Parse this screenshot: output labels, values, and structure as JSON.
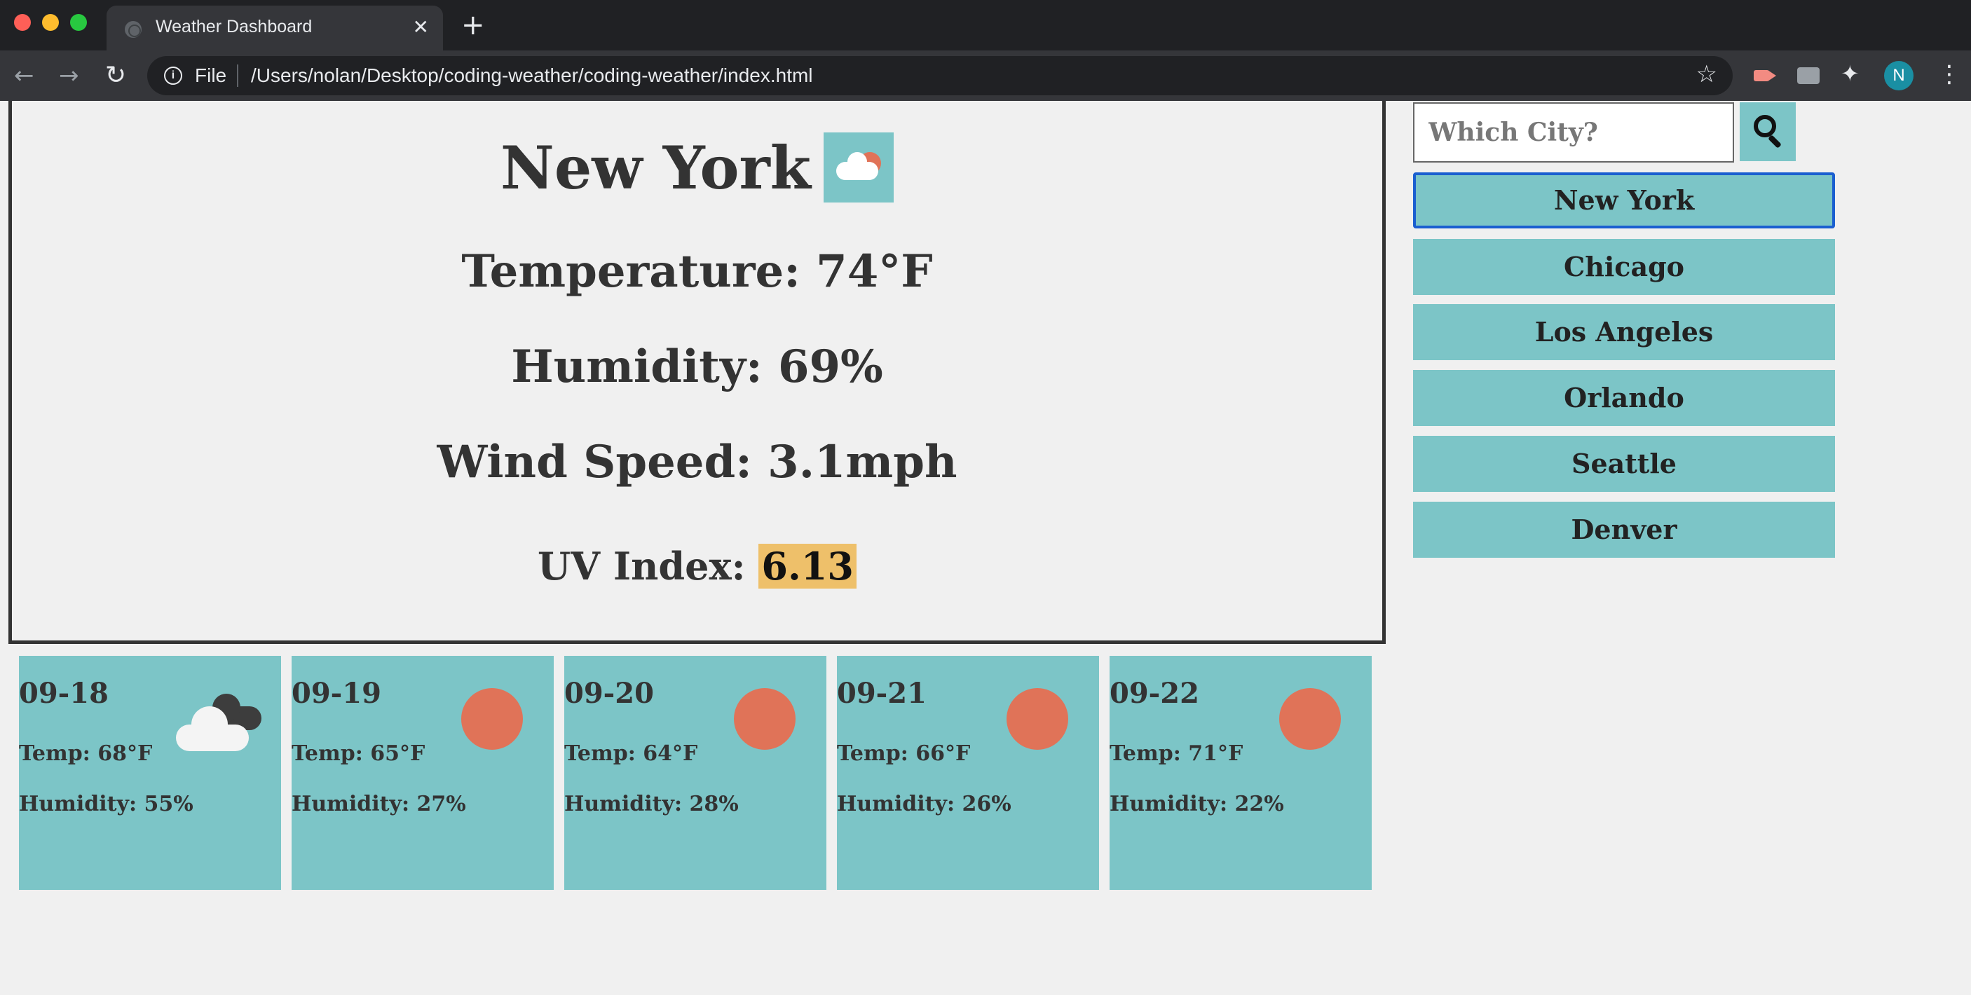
{
  "browser": {
    "tab_title": "Weather Dashboard",
    "tab_close": "✕",
    "new_tab": "+",
    "scheme": "File",
    "url": "/Users/nolan/Desktop/coding-weather/coding-weather/index.html",
    "profile_initial": "N"
  },
  "current": {
    "city": "New York",
    "temperature": "Temperature: 74°F",
    "humidity": "Humidity: 69%",
    "wind": "Wind Speed: 3.1mph",
    "uv_label": "UV Index: ",
    "uv_value": "6.13",
    "uv_color": "#eec06a",
    "icon": "partly-cloudy-icon"
  },
  "forecast": [
    {
      "date": "09-18",
      "temp": "Temp: 68°F",
      "humidity": "Humidity: 55%",
      "icon": "clouds-icon"
    },
    {
      "date": "09-19",
      "temp": "Temp: 65°F",
      "humidity": "Humidity: 27%",
      "icon": "sun-icon"
    },
    {
      "date": "09-20",
      "temp": "Temp: 64°F",
      "humidity": "Humidity: 28%",
      "icon": "sun-icon"
    },
    {
      "date": "09-21",
      "temp": "Temp: 66°F",
      "humidity": "Humidity: 26%",
      "icon": "sun-icon"
    },
    {
      "date": "09-22",
      "temp": "Temp: 71°F",
      "humidity": "Humidity: 22%",
      "icon": "sun-icon"
    }
  ],
  "sidebar": {
    "search_placeholder": "Which City?",
    "cities": [
      "New York",
      "Chicago",
      "Los Angeles",
      "Orlando",
      "Seattle",
      "Denver"
    ]
  },
  "colors": {
    "accent": "#7cc5c7",
    "sun": "#e07358",
    "page_bg": "#f0f0f0"
  }
}
